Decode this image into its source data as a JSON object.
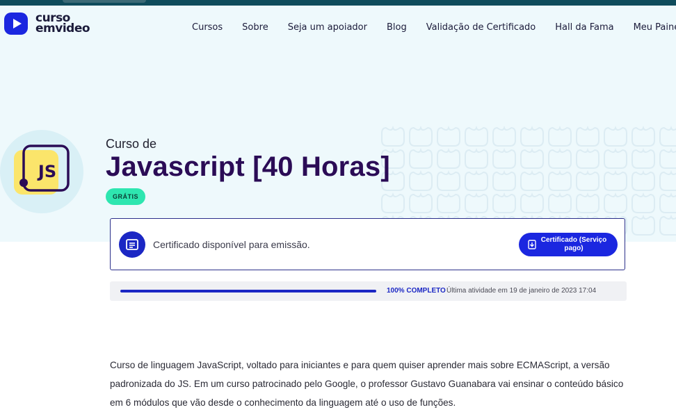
{
  "brand": {
    "line1": "curso",
    "line2": "emvideo",
    "accent_color": "#1b27e0"
  },
  "nav": {
    "items": [
      "Cursos",
      "Sobre",
      "Seja um apoiador",
      "Blog",
      "Validação de Certificado",
      "Hall da Fama",
      "Meu Painel"
    ]
  },
  "course": {
    "prefix": "Curso de",
    "title": "Javascript [40 Horas]",
    "badge": "GRÁTIS",
    "icon_label": "JS",
    "icon": "js-badge-icon"
  },
  "certificate": {
    "icon": "certificate-icon",
    "message": "Certificado disponível para emissão.",
    "button_label": "Certificado (Serviço pago)",
    "button_icon": "download-icon"
  },
  "progress": {
    "percent": 100,
    "label": "100% COMPLETO",
    "last_activity": "Última atividade em 19 de janeiro de 2023 17:04"
  },
  "description": "Curso de linguagem JavaScript, voltado para iniciantes e para quem quiser aprender mais sobre ECMAScript, a versão padronizada do JS. Em um curso patrocinado pelo Google, o professor Gustavo Guanabara vai ensinar o conteúdo básico em 6 módulos que vão desde o conhecimento da linguagem até o uso de funções.",
  "colors": {
    "hero_bg": "#eef9fc",
    "title": "#2b0c56",
    "badge_bg": "#2ee6b0",
    "progress": "#1b27c4"
  }
}
